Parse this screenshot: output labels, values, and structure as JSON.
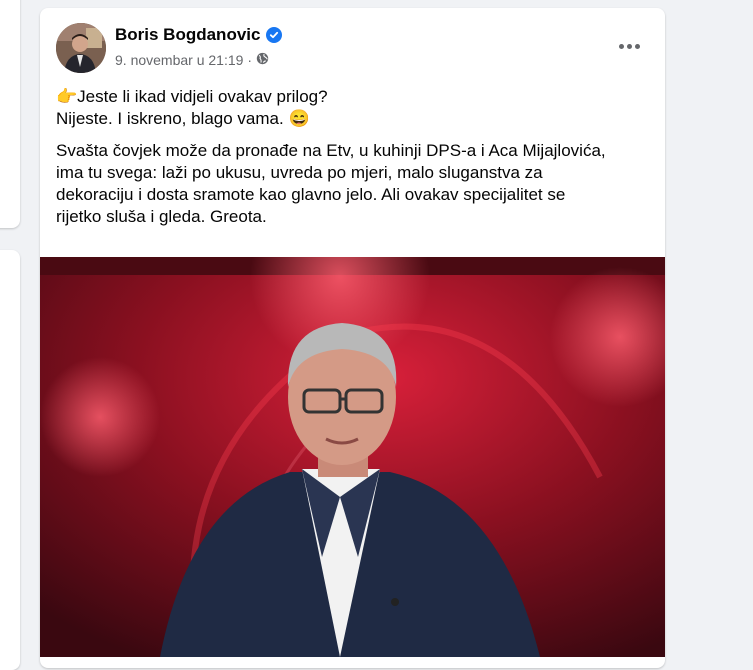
{
  "post": {
    "author": "Boris Bogdanovic",
    "date": "9. novembar u 21:19",
    "separator": "·",
    "privacy_icon": "globe-icon",
    "more_icon": "more-options-icon",
    "line1": "👉Jeste li ikad vidjeli ovakav prilog?",
    "line2": "Nijeste. I iskreno, blago vama. 😄",
    "body_lines": [
      "Svašta čovjek može da pronađe na Etv, u kuhinji DPS-a i Aca Mijajlovića,",
      "ima tu svega: laži po ukusu, uvreda po mjeri, malo sluganstva za",
      "dekoraciju i dosta sramote kao glavno jelo. Ali ovakav specijalitet se",
      "rijetko sluša i gleda. Greota."
    ]
  },
  "colors": {
    "verified": "#1877f2",
    "meta_text": "#65676b",
    "video_bg": "#6a0d18"
  }
}
